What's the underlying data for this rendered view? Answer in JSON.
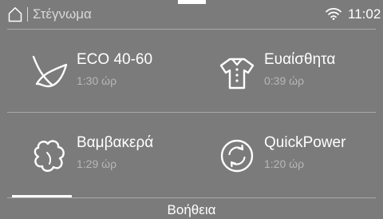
{
  "header": {
    "home_icon": "home-icon",
    "breadcrumb": "Στέγνωμα",
    "wifi_icon": "wifi-icon",
    "time": "11:02"
  },
  "programs": [
    {
      "name": "ECO 40-60",
      "duration": "1:30 ώρ",
      "icon": "leaf-icon"
    },
    {
      "name": "Ευαίσθητα",
      "duration": "0:39 ώρ",
      "icon": "shirt-icon"
    },
    {
      "name": "Βαμβακερά",
      "duration": "1:29 ώρ",
      "icon": "cotton-icon"
    },
    {
      "name": "QuickPower",
      "duration": "1:20 ώρ",
      "icon": "quickpower-icon"
    }
  ],
  "footer": {
    "help_label": "Βοήθεια"
  },
  "colors": {
    "background": "#7b7b7b",
    "text": "#ffffff",
    "secondary_text": "#b7b7b7",
    "divider": "#a9a9a9"
  }
}
